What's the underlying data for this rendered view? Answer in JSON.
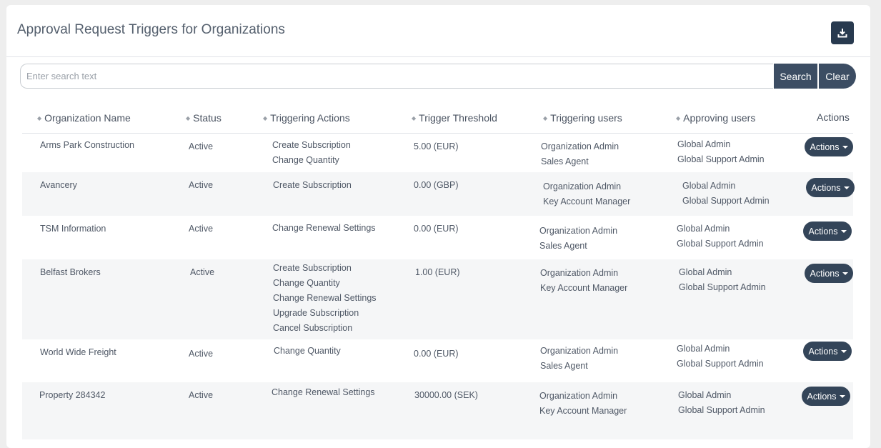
{
  "header": {
    "title": "Approval Request Triggers for Organizations",
    "download_icon": "download-icon"
  },
  "search": {
    "placeholder": "Enter search text",
    "value": "",
    "search_label": "Search",
    "clear_label": "Clear"
  },
  "table": {
    "columns": [
      "Organization Name",
      "Status",
      "Triggering Actions",
      "Trigger Threshold",
      "Triggering users",
      "Approving users",
      "Actions"
    ],
    "rows": [
      {
        "organization": "Arms Park Construction",
        "status": "Active",
        "triggering_actions": [
          "Create Subscription",
          "Change Quantity"
        ],
        "threshold": "5.00 (EUR)",
        "triggering_users": [
          "Organization Admin",
          "Sales Agent"
        ],
        "approving_users": [
          "Global Admin",
          "Global Support Admin"
        ],
        "actions_label": "Actions"
      },
      {
        "organization": "Avancery",
        "status": "Active",
        "triggering_actions": [
          "Create Subscription"
        ],
        "threshold": "0.00 (GBP)",
        "triggering_users": [
          "Organization Admin",
          "Key Account Manager"
        ],
        "approving_users": [
          "Global Admin",
          "Global Support Admin"
        ],
        "actions_label": "Actions"
      },
      {
        "organization": "TSM Information",
        "status": "Active",
        "triggering_actions": [
          "Change Renewal Settings"
        ],
        "threshold": "0.00 (EUR)",
        "triggering_users": [
          "Organization Admin",
          "Sales Agent"
        ],
        "approving_users": [
          "Global Admin",
          "Global Support Admin"
        ],
        "actions_label": "Actions"
      },
      {
        "organization": "Belfast Brokers",
        "status": "Active",
        "triggering_actions": [
          "Create Subscription",
          "Change Quantity",
          "Change Renewal Settings",
          "Upgrade Subscription",
          "Cancel Subscription"
        ],
        "threshold": "1.00 (EUR)",
        "triggering_users": [
          "Organization Admin",
          "Key Account Manager"
        ],
        "approving_users": [
          "Global Admin",
          "Global Support Admin"
        ],
        "actions_label": "Actions"
      },
      {
        "organization": "World Wide Freight",
        "status": "Active",
        "triggering_actions": [
          "Change Quantity"
        ],
        "threshold": "0.00 (EUR)",
        "triggering_users": [
          "Organization Admin",
          "Sales Agent"
        ],
        "approving_users": [
          "Global Admin",
          "Global Support Admin"
        ],
        "actions_label": "Actions"
      },
      {
        "organization": "Property 284342",
        "status": "Active",
        "triggering_actions": [
          "Change Renewal Settings"
        ],
        "threshold": "30000.00 (SEK)",
        "triggering_users": [
          "Organization Admin",
          "Key Account Manager"
        ],
        "approving_users": [
          "Global Admin",
          "Global Support Admin"
        ],
        "actions_label": "Actions"
      }
    ]
  }
}
